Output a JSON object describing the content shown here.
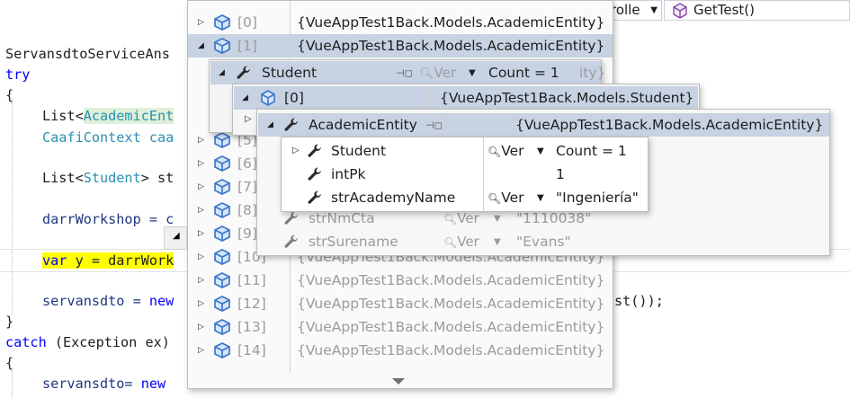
{
  "toolbar": {
    "class_combo_tail": "rolle",
    "method_combo": "GetTest()"
  },
  "code": {
    "line1": "ServansdtoServiceAns",
    "line2_kw": "try",
    "brace_open": "{",
    "line3_a": "List<",
    "line3_type": "AcademicEnt",
    "line4": "CaafiContext caa",
    "line5_a": "List<",
    "line5_type": "Student",
    "line5_b": "> st",
    "line6": "darrWorkshop = c",
    "line7_kw": "var",
    "line7_rest": " y = darrWork",
    "line8_a": "servansdto = ",
    "line8_kw": "new",
    "line8_tail": "st());",
    "brace_close": "}",
    "catch_kw": "catch",
    "catch_rest": " (Exception ex)",
    "brace_open2": "{",
    "last_a": "servansdto= ",
    "last_kw": "new"
  },
  "outer_list": {
    "items": [
      {
        "index": "[0]",
        "value": "{VueAppTest1Back.Models.AcademicEntity}"
      },
      {
        "index": "[1]",
        "value": "{VueAppTest1Back.Models.AcademicEntity}"
      },
      {
        "index": "[5]",
        "value": ""
      },
      {
        "index": "[6]",
        "value": ""
      },
      {
        "index": "[7]",
        "value": ""
      },
      {
        "index": "[8]",
        "value": ""
      },
      {
        "index": "[9]",
        "value": ""
      },
      {
        "index": "[10]",
        "value": "{VueAppTest1Back.Models.AcademicEntity}"
      },
      {
        "index": "[11]",
        "value": "{VueAppTest1Back.Models.AcademicEntity}"
      },
      {
        "index": "[12]",
        "value": "{VueAppTest1Back.Models.AcademicEntity}"
      },
      {
        "index": "[13]",
        "value": "{VueAppTest1Back.Models.AcademicEntity}"
      },
      {
        "index": "[14]",
        "value": "{VueAppTest1Back.Models.AcademicEntity}"
      }
    ]
  },
  "student_panel": {
    "name": "Student",
    "ver": "Ver",
    "value": "Count = 1",
    "tail": "ity}"
  },
  "student0_panel": {
    "index": "[0]",
    "value": "{VueAppTest1Back.Models.Student}"
  },
  "academic_panel": {
    "name": "AcademicEntity",
    "value": "{VueAppTest1Back.Models.AcademicEntity}",
    "behind_rows": [
      {
        "name": "strNmCta",
        "ver": "Ver",
        "value": "\"1110038\""
      },
      {
        "name": "strSurename",
        "ver": "Ver",
        "value": "\"Evans\""
      }
    ]
  },
  "academic_props": [
    {
      "name": "Student",
      "ver": "Ver",
      "value": "Count = 1"
    },
    {
      "name": "intPk",
      "ver": "",
      "value": "1"
    },
    {
      "name": "strAcademyName",
      "ver": "Ver",
      "value": "\"Ingeniería\""
    }
  ],
  "colors": {
    "selection": "#c7d2e3",
    "keyword": "#0000ff",
    "type": "#2b91af",
    "yellow_highlight": "#ffff00",
    "cube_icon": "#3c78c8"
  }
}
